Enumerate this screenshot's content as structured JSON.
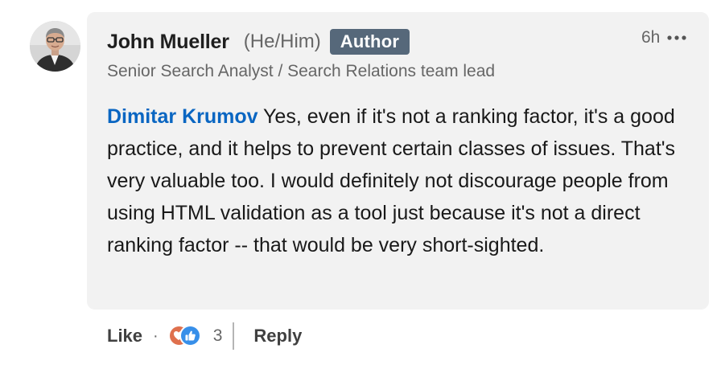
{
  "comment": {
    "author": {
      "name": "John Mueller",
      "pronouns": "(He/Him)",
      "badge": "Author",
      "headline": "Senior Search Analyst / Search Relations team lead",
      "avatar_icon": "profile-photo"
    },
    "timestamp": "6h",
    "more_icon": "ellipsis-icon",
    "mention": "Dimitar Krumov",
    "text": " Yes, even if it's not a ranking factor, it's a good practice, and it helps to prevent certain classes of issues. That's very valuable too. I would definitely not discourage people from using HTML validation as a tool just because it's not a direct ranking factor -- that would be very short-sighted."
  },
  "actions": {
    "like_label": "Like",
    "separator": "·",
    "reaction_icons": [
      "love-reaction-icon",
      "like-reaction-icon"
    ],
    "reaction_count": "3",
    "reply_label": "Reply"
  },
  "colors": {
    "bubble_bg": "#f2f2f2",
    "mention": "#0a66c2",
    "badge_bg": "#56687a",
    "love": "#df704d",
    "like": "#378fe9"
  }
}
